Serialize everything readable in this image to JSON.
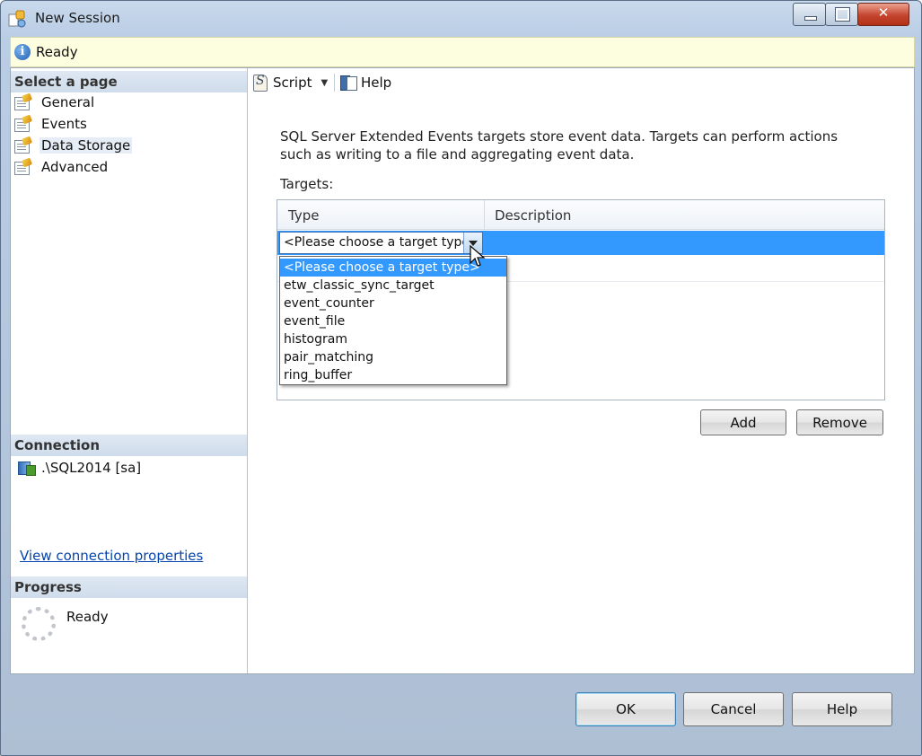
{
  "window": {
    "title": "New Session",
    "close_glyph": "✕"
  },
  "status": {
    "text": "Ready"
  },
  "sidebar": {
    "select_page_header": "Select a page",
    "pages": [
      {
        "label": "General"
      },
      {
        "label": "Events"
      },
      {
        "label": "Data Storage"
      },
      {
        "label": "Advanced"
      }
    ],
    "selected_page": "Data Storage",
    "connection_header": "Connection",
    "connection_value": ".\\SQL2014 [sa]",
    "connection_link": "View connection properties",
    "progress_header": "Progress",
    "progress_status": "Ready"
  },
  "toolbar": {
    "script_label": "Script",
    "help_label": "Help"
  },
  "main": {
    "description": "SQL Server Extended Events targets store event data. Targets can perform actions such as writing to a file and aggregating event data.",
    "targets_label": "Targets:",
    "columns": {
      "type": "Type",
      "description": "Description"
    },
    "combo_value": "<Please choose a target type>",
    "dropdown_options": [
      "<Please choose a target type>",
      "etw_classic_sync_target",
      "event_counter",
      "event_file",
      "histogram",
      "pair_matching",
      "ring_buffer"
    ],
    "add_label": "Add",
    "remove_label": "Remove"
  },
  "footer": {
    "ok_label": "OK",
    "cancel_label": "Cancel",
    "help_label": "Help"
  },
  "colors": {
    "selection": "#3399ff",
    "info_bar": "#fdfde0",
    "section_header": "#cfdceb"
  }
}
